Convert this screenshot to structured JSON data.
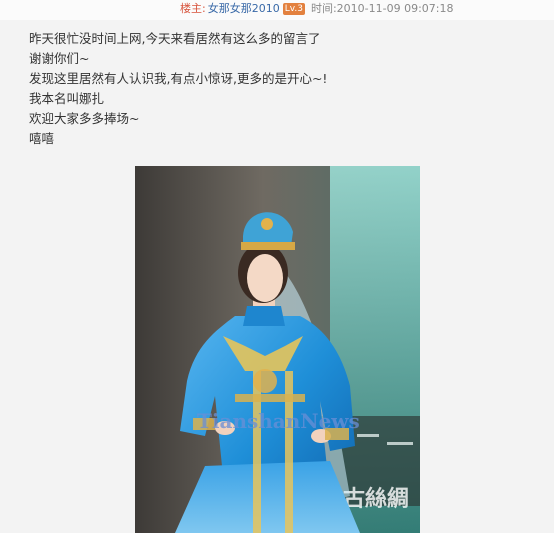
{
  "post_meta": {
    "poster_label": "楼主:",
    "username": "女那女那2010",
    "level_badge": "Lv.3",
    "time_label": "时间:",
    "time_value": "2010-11-09 09:07:18"
  },
  "post": {
    "lines": [
      "昨天很忙没时间上网,今天来看居然有这么多的留言了",
      "谢谢你们~",
      "发现这里居然有人认识我,有点小惊讶,更多的是开心~!",
      "我本名叫娜扎",
      "欢迎大家多多捧场~",
      "嘻嘻"
    ]
  },
  "photo": {
    "watermark": "TianshanNews",
    "banner_text": "古絲綢"
  },
  "colors": {
    "costume_blue": "#1f8fd8",
    "poster_label": "#d7543d",
    "username": "#3a6aa8",
    "badge": "#e3813f"
  }
}
